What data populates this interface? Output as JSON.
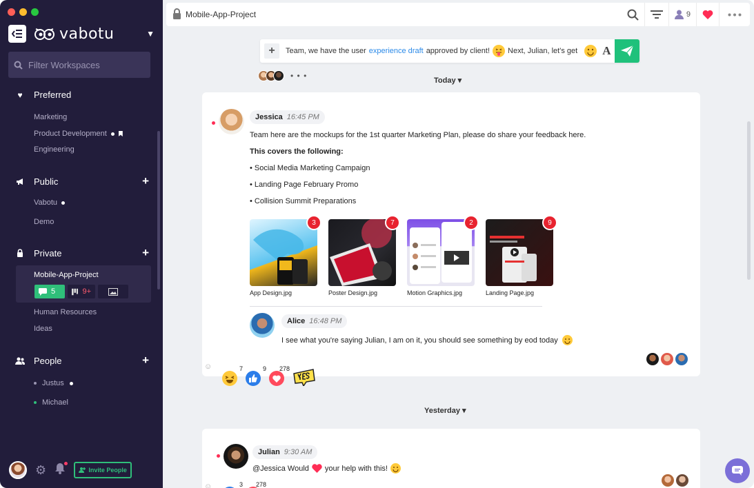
{
  "sidebar": {
    "brand": "vabotu",
    "filter_placeholder": "Filter Workspaces",
    "preferred": {
      "label": "Preferred",
      "items": [
        "Marketing",
        "Product Development",
        "Engineering"
      ]
    },
    "public": {
      "label": "Public",
      "items": [
        "Vabotu",
        "Demo"
      ]
    },
    "private": {
      "label": "Private",
      "active": {
        "label": "Mobile-App-Project",
        "messages": "5",
        "boards": "9+"
      },
      "items": [
        "Human Resources",
        "Ideas"
      ]
    },
    "people": {
      "label": "People",
      "items": [
        "Justus",
        "Michael"
      ]
    },
    "invite_label": "Invite People"
  },
  "topbar": {
    "title": "Mobile-App-Project",
    "members_count": "9"
  },
  "composer": {
    "text_before": "Team, we have the user",
    "link": "experience draft",
    "text_after": "approved by client!",
    "text_tail": "Next, Julian, let's get"
  },
  "dates": {
    "today": "Today ▾",
    "yesterday": "Yesterday ▾"
  },
  "post1": {
    "author": "Jessica",
    "time": "16:45 PM",
    "lines": [
      "Team here are the mockups for the 1st quarter Marketing Plan, please do share your feedback here.",
      "This covers the following:",
      "• Social Media Marketing Campaign",
      "• Landing Page February Promo",
      "• Collision Summit Preparations"
    ],
    "attachments": [
      {
        "name": "App Design.jpg",
        "count": "3"
      },
      {
        "name": "Poster Design.jpg",
        "count": "7"
      },
      {
        "name": "Motion Graphics.jpg",
        "count": "2"
      },
      {
        "name": "Landing Page.jpg",
        "count": "9"
      }
    ],
    "reply": {
      "author": "Alice",
      "time": "16:48 PM",
      "text": "I see what you're saying Julian, I am on it, you should see something by eod today"
    },
    "reactions": {
      "laugh": "7",
      "like": "9",
      "love": "278"
    }
  },
  "post2": {
    "author": "Julian",
    "time": "9:30 AM",
    "text_before": "@Jessica Would",
    "text_after": "your help with this!",
    "reactions": {
      "like": "3",
      "love": "278"
    }
  },
  "colors": {
    "sidebar": "#221d3b",
    "accent_green": "#1fc17b",
    "alert_red": "#e8232f",
    "link_blue": "#2b8ae8"
  }
}
